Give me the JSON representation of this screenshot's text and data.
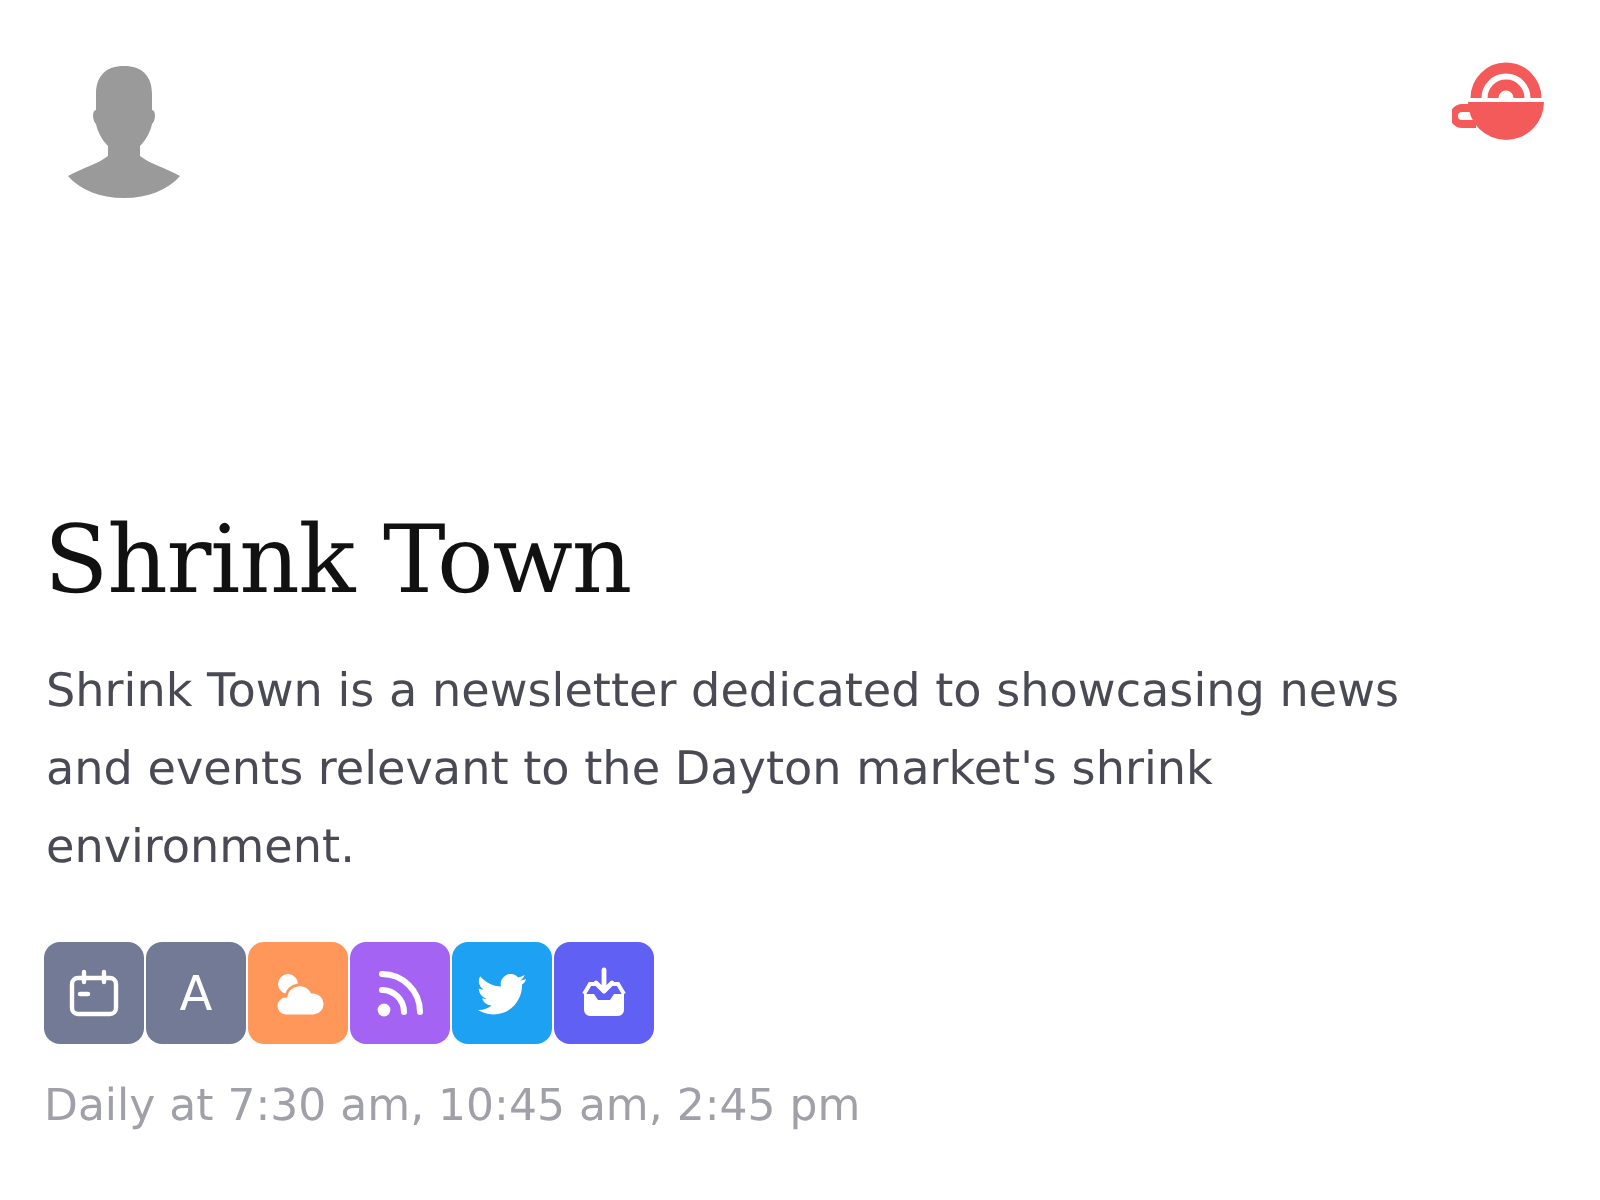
{
  "publication": {
    "title": "Shrink Town",
    "description": "Shrink Town is a newsletter dedicated to showcasing news and events relevant to the Dayton market's shrink environment."
  },
  "channels": [
    {
      "kind": "calendar",
      "color": "#737a96"
    },
    {
      "kind": "letter",
      "label": "A",
      "color": "#737a96"
    },
    {
      "kind": "cloud",
      "color": "#ff965a"
    },
    {
      "kind": "rss",
      "color": "#a463f2"
    },
    {
      "kind": "bird",
      "color": "#1da1f2"
    },
    {
      "kind": "inbox",
      "color": "#6160f5"
    }
  ],
  "schedule": "Daily at 7:30 am, 10:45 am, 2:45 pm"
}
